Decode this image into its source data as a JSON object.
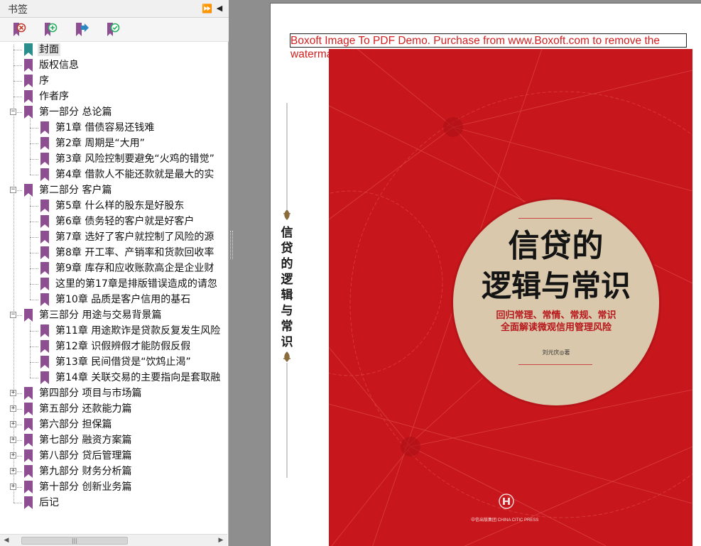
{
  "panel": {
    "title": "书签",
    "collapse_glyph": "⏩",
    "close_glyph": "◀"
  },
  "toolbar": {
    "buttons": [
      {
        "name": "delete-bookmark-button",
        "icon": "bookmark-delete-icon",
        "color": "#c0392b"
      },
      {
        "name": "add-bookmark-button",
        "icon": "bookmark-add-icon",
        "color": "#27ae60"
      },
      {
        "name": "go-to-bookmark-button",
        "icon": "bookmark-goto-icon",
        "color": "#2e86c1"
      },
      {
        "name": "confirm-bookmark-button",
        "icon": "bookmark-check-icon",
        "color": "#27ae60"
      }
    ]
  },
  "bookmarks": [
    {
      "label": "封面",
      "level": 0,
      "expander": "",
      "icon": "teal",
      "selected": true
    },
    {
      "label": "版权信息",
      "level": 0,
      "expander": "",
      "icon": "purple"
    },
    {
      "label": "序",
      "level": 0,
      "expander": "",
      "icon": "purple"
    },
    {
      "label": "作者序",
      "level": 0,
      "expander": "",
      "icon": "purple"
    },
    {
      "label": "第一部分 总论篇",
      "level": 0,
      "expander": "−",
      "icon": "purple"
    },
    {
      "label": "第1章 借债容易还钱难",
      "level": 1,
      "expander": "",
      "icon": "purple"
    },
    {
      "label": "第2章 周期是“大用”",
      "level": 1,
      "expander": "",
      "icon": "purple"
    },
    {
      "label": "第3章 风险控制要避免“火鸡的错觉”",
      "level": 1,
      "expander": "",
      "icon": "purple"
    },
    {
      "label": "第4章 借款人不能还款就是最大的实",
      "level": 1,
      "expander": "",
      "icon": "purple"
    },
    {
      "label": "第二部分 客户篇",
      "level": 0,
      "expander": "−",
      "icon": "purple"
    },
    {
      "label": "第5章 什么样的股东是好股东",
      "level": 1,
      "expander": "",
      "icon": "purple"
    },
    {
      "label": "第6章 债务轻的客户就是好客户",
      "level": 1,
      "expander": "",
      "icon": "purple"
    },
    {
      "label": "第7章 选好了客户就控制了风险的源",
      "level": 1,
      "expander": "",
      "icon": "purple"
    },
    {
      "label": "第8章 开工率、产销率和货款回收率",
      "level": 1,
      "expander": "",
      "icon": "purple"
    },
    {
      "label": "第9章 库存和应收账款高企是企业财",
      "level": 1,
      "expander": "",
      "icon": "purple"
    },
    {
      "label": "这里的第17章是排版错误造成的请忽",
      "level": 1,
      "expander": "",
      "icon": "purple"
    },
    {
      "label": "第10章 品质是客户信用的基石",
      "level": 1,
      "expander": "",
      "icon": "purple"
    },
    {
      "label": "第三部分 用途与交易背景篇",
      "level": 0,
      "expander": "−",
      "icon": "purple"
    },
    {
      "label": "第11章 用途欺诈是贷款反复发生风险",
      "level": 1,
      "expander": "",
      "icon": "purple"
    },
    {
      "label": "第12章 识假辨假才能防假反假",
      "level": 1,
      "expander": "",
      "icon": "purple"
    },
    {
      "label": "第13章 民间借贷是“饮鸩止渴”",
      "level": 1,
      "expander": "",
      "icon": "purple"
    },
    {
      "label": "第14章 关联交易的主要指向是套取融",
      "level": 1,
      "expander": "",
      "icon": "purple"
    },
    {
      "label": "第四部分 项目与市场篇",
      "level": 0,
      "expander": "+",
      "icon": "purple"
    },
    {
      "label": "第五部分 还款能力篇",
      "level": 0,
      "expander": "+",
      "icon": "purple"
    },
    {
      "label": "第六部分 担保篇",
      "level": 0,
      "expander": "+",
      "icon": "purple"
    },
    {
      "label": "第七部分 融资方案篇",
      "level": 0,
      "expander": "+",
      "icon": "purple"
    },
    {
      "label": "第八部分 贷后管理篇",
      "level": 0,
      "expander": "+",
      "icon": "purple"
    },
    {
      "label": "第九部分 财务分析篇",
      "level": 0,
      "expander": "+",
      "icon": "purple"
    },
    {
      "label": "第十部分 创新业务篇",
      "level": 0,
      "expander": "+",
      "icon": "purple"
    },
    {
      "label": "后记",
      "level": 0,
      "expander": "",
      "icon": "purple"
    }
  ],
  "scrollbar": {
    "left_arrow": "◀",
    "right_arrow": "▶",
    "thumb_grip": "|||"
  },
  "document": {
    "watermark": "Boxoft Image To PDF Demo. Purchase from www.Boxoft.com to remove the watermark",
    "spine_title": "信贷的逻辑与常识",
    "cover": {
      "title_line1": "信贷的",
      "title_line2": "逻辑与常识",
      "subtitle_line1": "回归常理、常情、常规、常识",
      "subtitle_line2": "全面解读微观信用管理风险",
      "author": "刘元庆◎著",
      "publisher": "中信出版集团 CHINA CITIC PRESS"
    }
  },
  "colors": {
    "cover_red": "#c8171c",
    "circle_beige": "#d9c8ab",
    "bookmark_purple": "#8e4f92",
    "bookmark_teal": "#2a8f8c",
    "watermark_red": "#d21f1f"
  }
}
